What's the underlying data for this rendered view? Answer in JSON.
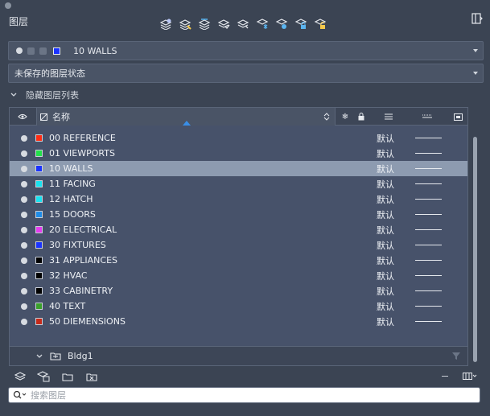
{
  "panel": {
    "title": "图层"
  },
  "toolbar": {
    "icons": [
      "new-layer-icon",
      "new-vp-frozen-icon",
      "delete-layer-icon",
      "set-current-icon",
      "merge-icon",
      "freeze-icon",
      "isolate-icon",
      "lock-icon",
      "unlock-icon"
    ]
  },
  "current_layer": {
    "name": "10 WALLS",
    "color": "#1a33ff"
  },
  "layer_state": {
    "label": "未保存的图层状态"
  },
  "hide_list": {
    "label": "隐藏图层列表"
  },
  "table": {
    "header_name": "名称",
    "rows": [
      {
        "name": "00 REFERENCE",
        "color": "#ff2b12",
        "linetype": "默认"
      },
      {
        "name": "01 VIEWPORTS",
        "color": "#22e04a",
        "linetype": "默认"
      },
      {
        "name": "10 WALLS",
        "color": "#1a33ff",
        "linetype": "默认",
        "selected": true
      },
      {
        "name": "11 FACING",
        "color": "#18e2f0",
        "linetype": "默认"
      },
      {
        "name": "12 HATCH",
        "color": "#18e2f0",
        "linetype": "默认"
      },
      {
        "name": "15 DOORS",
        "color": "#1f8ce8",
        "linetype": "默认"
      },
      {
        "name": "20 ELECTRICAL",
        "color": "#e53cf0",
        "linetype": "默认"
      },
      {
        "name": "30 FIXTURES",
        "color": "#1a33ff",
        "linetype": "默认"
      },
      {
        "name": "31 APPLIANCES",
        "color": "#000000",
        "linetype": "默认"
      },
      {
        "name": "32 HVAC",
        "color": "#000000",
        "linetype": "默认"
      },
      {
        "name": "33 CABINETRY",
        "color": "#000000",
        "linetype": "默认"
      },
      {
        "name": "40 TEXT",
        "color": "#3aa02a",
        "linetype": "默认"
      },
      {
        "name": "50 DIEMENSIONS",
        "color": "#c62a1a",
        "linetype": "默认"
      }
    ],
    "group": {
      "name": "Bldg1"
    }
  },
  "search": {
    "placeholder": "搜索图层"
  }
}
